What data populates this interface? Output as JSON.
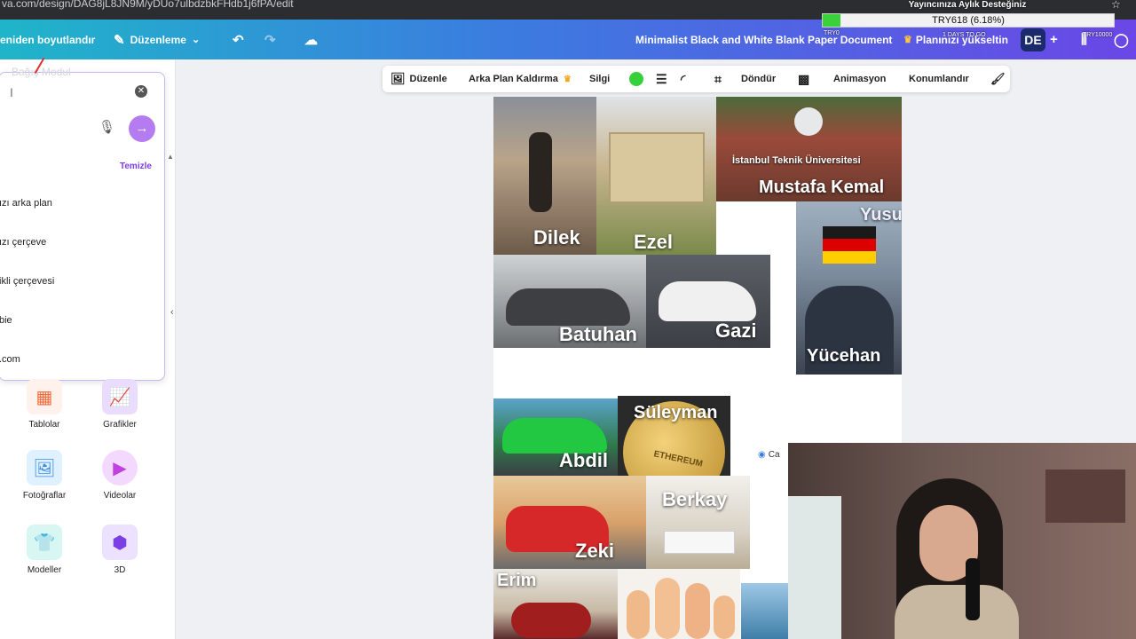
{
  "browser": {
    "url": "va.com/design/DAG8jL8JN9M/yDUo7ulbdzbkFHdb1j6fPA/edit"
  },
  "topbar": {
    "resize_label": "eniden boyutlandır",
    "edit_label": "Düzenleme",
    "doc_title": "Minimalist Black and White Blank Paper Document",
    "upgrade_label": "Planınızı yükseltin",
    "avatar_initials": "DE"
  },
  "overlay": {
    "title": "Yayıncınıza Aylık Desteğiniz",
    "progress_text": "TRY618 (6.18%)",
    "progress_fraction": 0.0618,
    "left_label": "TRY0",
    "days_label": "1 DAYS TO GO",
    "right_label": "TRY10000"
  },
  "popup": {
    "ghost_text": "Bağış Modul",
    "clear_label": "Temizle",
    "suggestions": [
      "ızı arka plan",
      "ızı çerçeve",
      "ikli çerçevesi",
      "bie",
      ".com"
    ]
  },
  "apps": [
    {
      "label": "Tablolar",
      "icon": "table-icon"
    },
    {
      "label": "Grafikler",
      "icon": "chart-icon"
    },
    {
      "label": "Fotoğraflar",
      "icon": "photo-icon"
    },
    {
      "label": "Videolar",
      "icon": "video-icon"
    },
    {
      "label": "Modeller",
      "icon": "tshirt-icon"
    },
    {
      "label": "3D",
      "icon": "cube-icon"
    }
  ],
  "image_toolbar": {
    "edit": "Düzenle",
    "bg_remove": "Arka Plan Kaldırma",
    "erase": "Silgi",
    "rotate": "Döndür",
    "animate": "Animasyon",
    "position": "Konumlandır",
    "color": "#35d03a"
  },
  "collage": {
    "dilek": "Dilek",
    "ezel": "Ezel",
    "mustafa": "Mustafa Kemal",
    "itu_sign": "İstanbul Teknik Üniversitesi",
    "yusuf": "Yusuf",
    "batuhan": "Batuhan",
    "gazi": "Gazi",
    "yucehan": "Yücehan",
    "abdil": "Abdil",
    "suleyman": "Süleyman",
    "ethereum": "ETHEREUM",
    "berkay": "Berkay",
    "zeki": "Zeki",
    "erim": "Erim"
  },
  "ca_badge": "Ca"
}
